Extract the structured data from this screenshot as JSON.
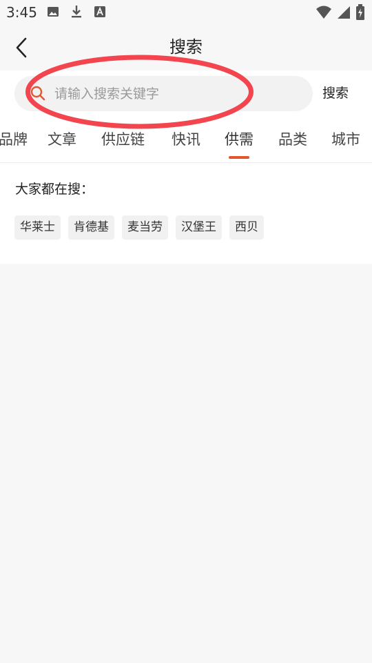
{
  "status_bar": {
    "time": "3:45",
    "left_icons": [
      "image-icon",
      "download-icon",
      "text-a-icon"
    ],
    "right_icons": [
      "wifi-icon",
      "signal-icon",
      "battery-charging-icon"
    ]
  },
  "header": {
    "title": "搜索",
    "back_icon": "chevron-left-icon"
  },
  "search": {
    "placeholder": "请输入搜索关键字",
    "value": "",
    "button_label": "搜索",
    "icon": "search-icon",
    "accent_color": "#e4572e"
  },
  "tabs": [
    {
      "label": "品牌"
    },
    {
      "label": "文章"
    },
    {
      "label": "供应链"
    },
    {
      "label": "快讯"
    },
    {
      "label": "供需",
      "active": true
    },
    {
      "label": "品类"
    },
    {
      "label": "城市"
    }
  ],
  "hot_search": {
    "label": "大家都在搜：",
    "tags": [
      "华莱士",
      "肯德基",
      "麦当劳",
      "汉堡王",
      "西贝"
    ]
  },
  "annotation": {
    "shape": "ellipse",
    "color": "#f2454e"
  },
  "colors": {
    "background": "#f7f7f7",
    "panel": "#ffffff",
    "tab_indicator": "#e4572e"
  }
}
